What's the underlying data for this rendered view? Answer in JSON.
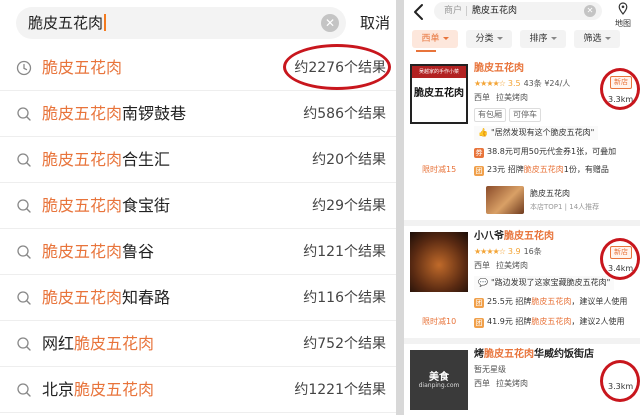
{
  "left": {
    "search": {
      "query": "脆皮五花肉",
      "cancel_label": "取消",
      "clear_icon": "clear-icon"
    },
    "suggestions": [
      {
        "icon": "history-clock-icon",
        "prefix": "",
        "highlight": "脆皮五花肉",
        "suffix": "",
        "count": "约2276个结果"
      },
      {
        "icon": "search-icon",
        "prefix": "",
        "highlight": "脆皮五花肉",
        "suffix": "南锣鼓巷",
        "count": "约586个结果"
      },
      {
        "icon": "search-icon",
        "prefix": "",
        "highlight": "脆皮五花肉",
        "suffix": "合生汇",
        "count": "约20个结果"
      },
      {
        "icon": "search-icon",
        "prefix": "",
        "highlight": "脆皮五花肉",
        "suffix": "食宝街",
        "count": "约29个结果"
      },
      {
        "icon": "search-icon",
        "prefix": "",
        "highlight": "脆皮五花肉",
        "suffix": "鲁谷",
        "count": "约121个结果"
      },
      {
        "icon": "search-icon",
        "prefix": "",
        "highlight": "脆皮五花肉",
        "suffix": "知春路",
        "count": "约116个结果"
      },
      {
        "icon": "search-icon",
        "prefix": "网红",
        "highlight": "脆皮五花肉",
        "suffix": "",
        "count": "约752个结果"
      },
      {
        "icon": "search-icon",
        "prefix": "北京",
        "highlight": "脆皮五花肉",
        "suffix": "",
        "count": "约1221个结果"
      }
    ]
  },
  "right": {
    "search": {
      "prefix": "商户",
      "query": "脆皮五花肉",
      "map_label": "地图"
    },
    "filters": [
      {
        "label": "西单",
        "active": true
      },
      {
        "label": "分类",
        "active": false
      },
      {
        "label": "排序",
        "active": false
      },
      {
        "label": "筛选",
        "active": false
      }
    ],
    "cards": [
      {
        "thumb_text": "脆皮五花肉",
        "thumb_top": "吴越家的手作小菜",
        "title_highlight": "脆皮五花肉",
        "title_suffix": "",
        "stars": "★★★★☆",
        "score": "3.5",
        "meta": "43条 ¥24/人",
        "area": "西单",
        "category": "拉美烤肉",
        "tags": [
          "有包厢",
          "可停车"
        ],
        "quote": "\"居然发现有这个脆皮五花肉\"",
        "deals": [
          {
            "icon": "券",
            "text_pre": "38.8元可用50元代金券1张，可叠加",
            "hl": "",
            "text_post": ""
          },
          {
            "icon": "团",
            "text_pre": "23元 招牌",
            "hl": "脆皮五花肉",
            "text_post": "1份，有赠品"
          }
        ],
        "limit_label": "限时减15",
        "dish_name": "脆皮五花肉",
        "dish_rank": "本店TOP1 | 14人推荐",
        "badge": "新店",
        "distance": "3.3km"
      },
      {
        "title_pre": "小八爷",
        "title_highlight": "脆皮五花肉",
        "stars": "★★★★☆",
        "score": "3.9",
        "meta": "16条",
        "area": "西单",
        "category": "拉美烤肉",
        "quote": "\"路边发现了这家宝藏脆皮五花肉\"",
        "deals": [
          {
            "icon": "团",
            "text_pre": "25.5元 招牌",
            "hl": "脆皮五花肉",
            "text_post": "，建议单人使用"
          },
          {
            "icon": "团",
            "text_pre": "41.9元 招牌",
            "hl": "脆皮五花肉",
            "text_post": "，建议2人使用"
          }
        ],
        "limit_label": "限时减10",
        "badge": "新店",
        "distance": "3.4km"
      },
      {
        "title_pre": "烤",
        "title_highlight": "脆皮五花肉",
        "title_suffix": "华威约饭街店",
        "rating_text": "暂无星级",
        "area": "西单",
        "category": "拉美烤肉",
        "thumb_text": "美食",
        "thumb_sub": "dianping.com",
        "distance": "3.3km"
      }
    ]
  }
}
